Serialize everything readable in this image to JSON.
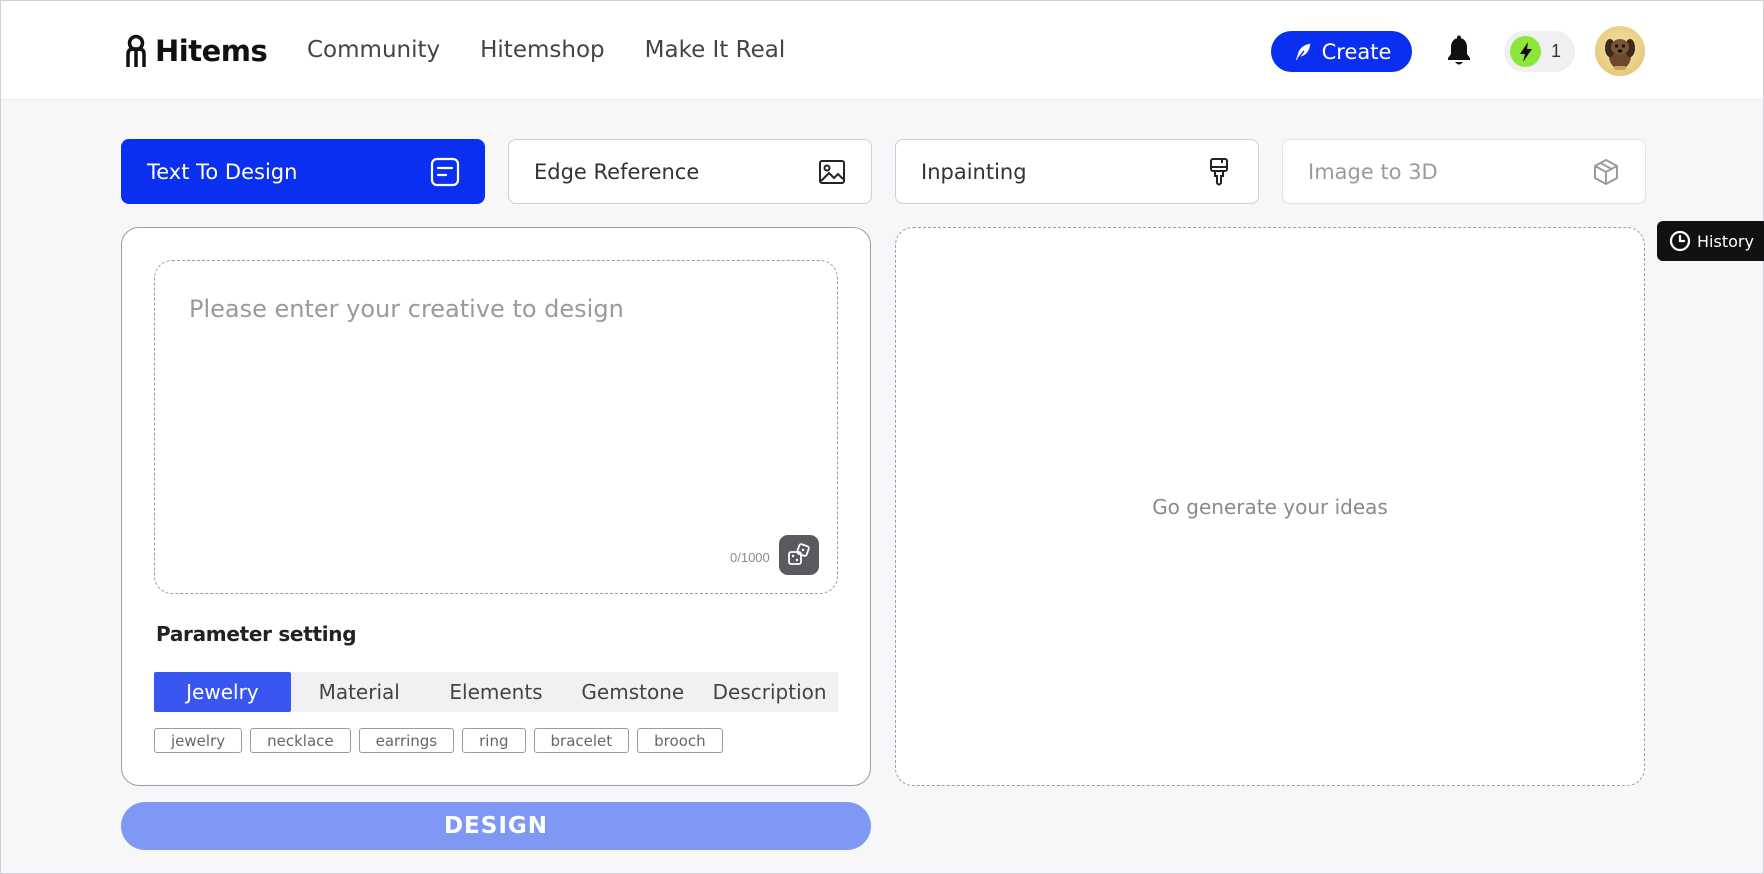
{
  "header": {
    "logo_text": "Hitems",
    "nav": [
      "Community",
      "Hitemshop",
      "Make It Real"
    ],
    "create_label": "Create",
    "credits_count": "1"
  },
  "modes": [
    {
      "label": "Text To Design",
      "icon": "text-doc-icon",
      "active": true
    },
    {
      "label": "Edge Reference",
      "icon": "image-icon"
    },
    {
      "label": "Inpainting",
      "icon": "paint-brush-icon"
    },
    {
      "label": "Image to 3D",
      "icon": "cube-icon",
      "disabled": true
    }
  ],
  "prompt": {
    "placeholder": "Please enter your creative to design",
    "value": "",
    "char_count": "0/1000"
  },
  "parameters": {
    "title": "Parameter setting",
    "tabs": [
      "Jewelry",
      "Material",
      "Elements",
      "Gemstone",
      "Description"
    ],
    "active_tab": "Jewelry",
    "chips": [
      "jewelry",
      "necklace",
      "earrings",
      "ring",
      "bracelet",
      "brooch"
    ]
  },
  "design_label": "DESIGN",
  "result": {
    "placeholder": "Go generate your ideas"
  },
  "history_label": "History",
  "colors": {
    "accent": "#0a2ff0",
    "tab_active": "#3a56f0",
    "design_button": "#7f98f4",
    "credit_bolt": "#8de63a"
  }
}
